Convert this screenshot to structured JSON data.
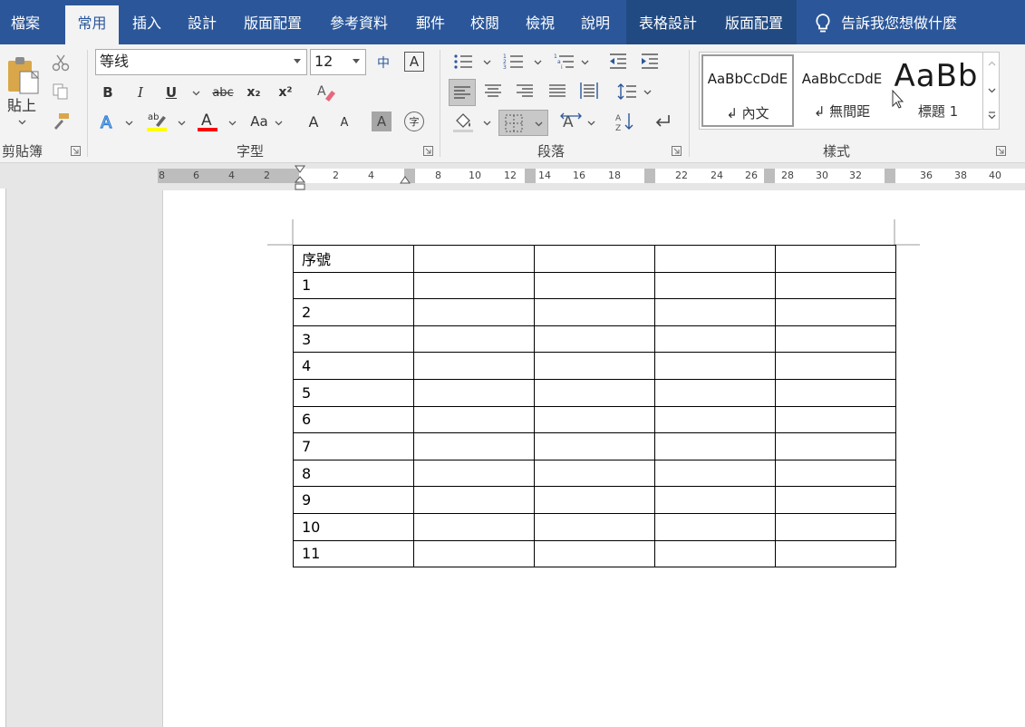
{
  "tabs": [
    {
      "label": "檔案",
      "active": false
    },
    {
      "label": "常用",
      "active": true
    },
    {
      "label": "插入",
      "active": false
    },
    {
      "label": "設計",
      "active": false
    },
    {
      "label": "版面配置",
      "active": false
    },
    {
      "label": "參考資料",
      "active": false
    },
    {
      "label": "郵件",
      "active": false
    },
    {
      "label": "校閱",
      "active": false
    },
    {
      "label": "檢視",
      "active": false
    },
    {
      "label": "說明",
      "active": false
    },
    {
      "label": "表格設計",
      "active": false
    },
    {
      "label": "版面配置",
      "active": false
    }
  ],
  "tell_me": "告訴我您想做什麼",
  "clipboard": {
    "paste_label": "貼上",
    "group_label": "剪貼簿"
  },
  "font": {
    "name": "等线",
    "size": "12",
    "group_label": "字型",
    "bold": "B",
    "italic": "I",
    "underline": "U",
    "strikethrough": "abc",
    "subscript": "x₂",
    "superscript": "x²",
    "change_case": "Aa",
    "grow": "A",
    "shrink": "A",
    "phonetic": "中",
    "char_border": "A",
    "char_shading": "A",
    "enclose": "字"
  },
  "paragraph": {
    "group_label": "段落"
  },
  "styles": {
    "group_label": "樣式",
    "items": [
      {
        "sample": "AaBbCcDdE",
        "name": "內文"
      },
      {
        "sample": "AaBbCcDdE",
        "name": "無間距"
      },
      {
        "sample": "AaBb",
        "name": "標題 1"
      }
    ]
  },
  "colors": {
    "ribbon_blue": "#2b579a",
    "highlight": "#ffff00",
    "font_color": "#ff0000"
  },
  "ruler": {
    "left_numbers": [
      "8",
      "6",
      "4",
      "2"
    ],
    "right_numbers": [
      "2",
      "4",
      "8",
      "10",
      "12",
      "14",
      "16",
      "18",
      "22",
      "24",
      "26",
      "28",
      "30",
      "32",
      "36",
      "38",
      "40"
    ]
  },
  "table": {
    "rows": [
      [
        "序號",
        "",
        "",
        "",
        ""
      ],
      [
        "1",
        "",
        "",
        "",
        ""
      ],
      [
        "2",
        "",
        "",
        "",
        ""
      ],
      [
        "3",
        "",
        "",
        "",
        ""
      ],
      [
        "4",
        "",
        "",
        "",
        ""
      ],
      [
        "5",
        "",
        "",
        "",
        ""
      ],
      [
        "6",
        "",
        "",
        "",
        ""
      ],
      [
        "7",
        "",
        "",
        "",
        ""
      ],
      [
        "8",
        "",
        "",
        "",
        ""
      ],
      [
        "9",
        "",
        "",
        "",
        ""
      ],
      [
        "10",
        "",
        "",
        "",
        ""
      ],
      [
        "11",
        "",
        "",
        "",
        ""
      ]
    ]
  }
}
